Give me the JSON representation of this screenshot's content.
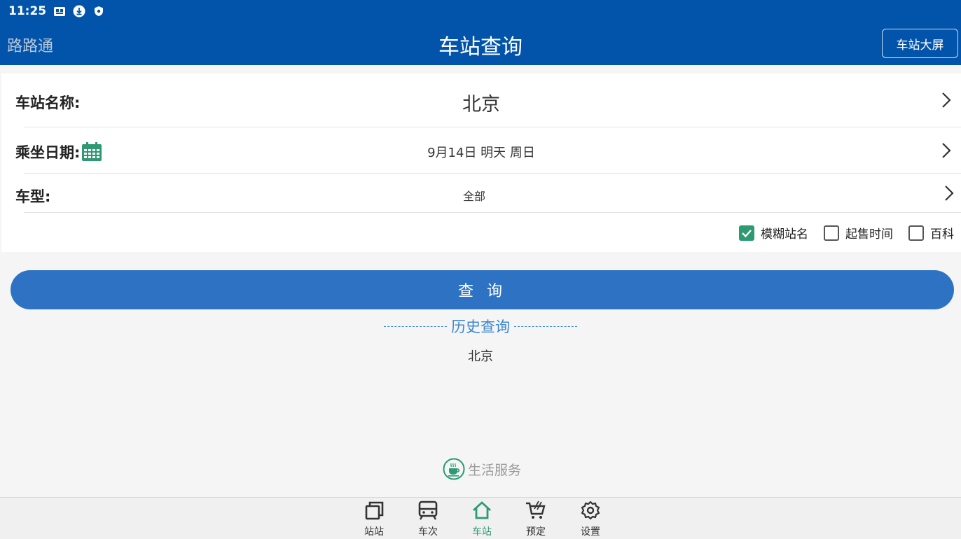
{
  "status": {
    "time": "11:25",
    "icons": [
      "app-notification-icon",
      "download-icon",
      "vpn-shield-icon"
    ]
  },
  "appbar": {
    "brand": "路路通",
    "title": "车站查询",
    "right_button": "车站大屏"
  },
  "form": {
    "station": {
      "label": "车站名称:",
      "value": "北京"
    },
    "date": {
      "label": "乘坐日期:",
      "value": "9月14日 明天 周日",
      "icon": "calendar-icon"
    },
    "type": {
      "label": "车型:",
      "value": "全部"
    },
    "options": [
      {
        "label": "模糊站名",
        "checked": true
      },
      {
        "label": "起售时间",
        "checked": false
      },
      {
        "label": "百科",
        "checked": false
      }
    ]
  },
  "query_button": "查 询",
  "history": {
    "title": "历史查询",
    "items": [
      "北京"
    ]
  },
  "life_service": {
    "label": "生活服务",
    "icon": "coffee-cup-icon"
  },
  "colors": {
    "primary": "#0254ab",
    "button": "#2e73c3",
    "accent": "#2d9a73",
    "link": "#3c88d0"
  },
  "tabs": [
    {
      "label": "站站",
      "icon": "copy-icon"
    },
    {
      "label": "车次",
      "icon": "train-icon"
    },
    {
      "label": "车站",
      "icon": "home-icon",
      "active": true
    },
    {
      "label": "预定",
      "icon": "cart-icon"
    },
    {
      "label": "设置",
      "icon": "gear-icon"
    }
  ]
}
